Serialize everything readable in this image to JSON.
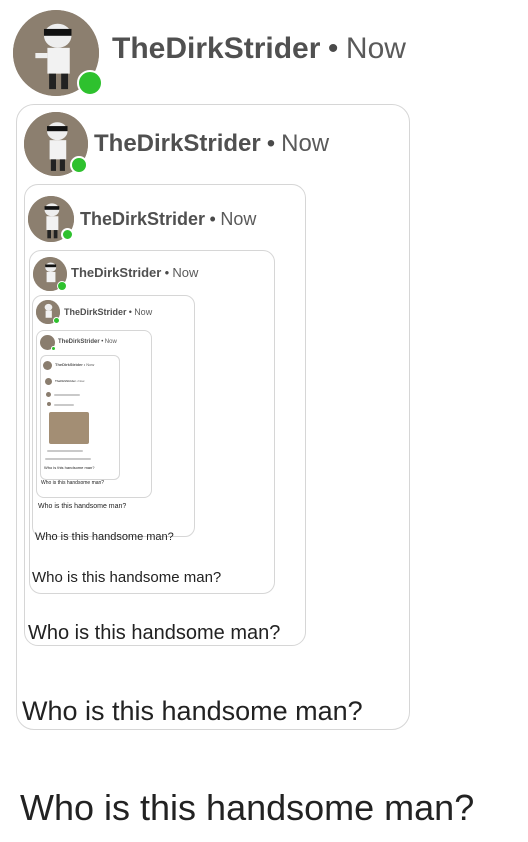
{
  "post": {
    "username": "TheDirkStrider",
    "separator": "•",
    "time": "Now",
    "text": "Who is this handsome man?"
  },
  "colors": {
    "online": "#2ec12e",
    "card_border": "#d6d6d6",
    "avatar_bg": "#8a7d6e"
  },
  "icons": {
    "avatar": "avatar-image",
    "status": "online-status-dot"
  }
}
